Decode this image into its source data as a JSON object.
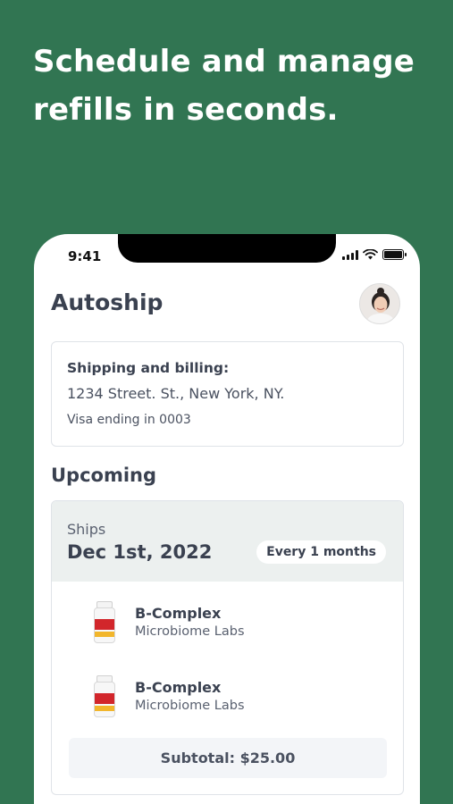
{
  "headline": "Schedule and manage refills in seconds.",
  "status_bar": {
    "time": "9:41"
  },
  "page": {
    "title": "Autoship"
  },
  "shipping": {
    "title": "Shipping and billing:",
    "address": "1234 Street. St., New York, NY.",
    "payment": "Visa ending in 0003"
  },
  "upcoming": {
    "section_title": "Upcoming",
    "ships_label": "Ships",
    "date": "Dec 1st, 2022",
    "frequency": "Every 1 months",
    "items": [
      {
        "name": "B-Complex",
        "brand": "Microbiome Labs"
      },
      {
        "name": "B-Complex",
        "brand": "Microbiome Labs"
      }
    ],
    "subtotal": "Subtotal: $25.00"
  },
  "colors": {
    "background": "#317552",
    "text": "#3a4150",
    "panel": "#ecf0ef"
  }
}
